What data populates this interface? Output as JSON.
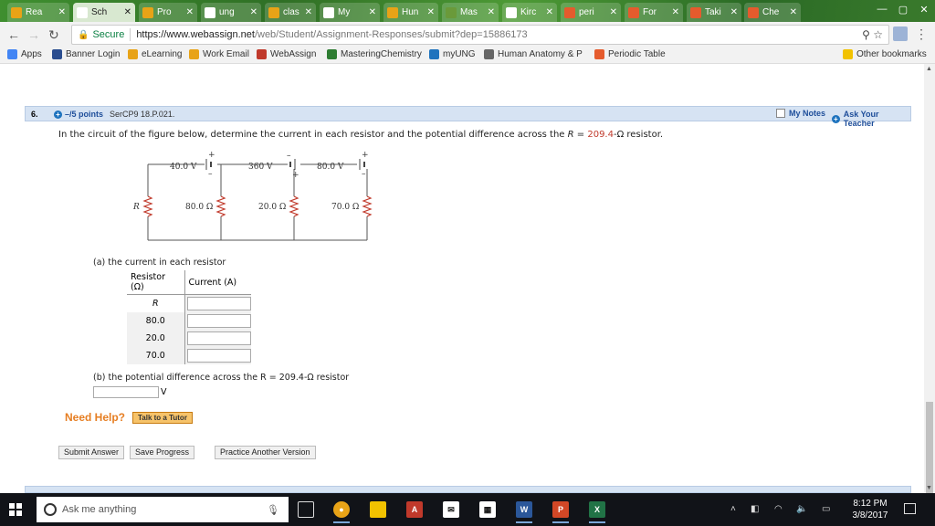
{
  "tabs": [
    {
      "label": "Rea",
      "icon": "scholarship-icon",
      "color": "#e8a317"
    },
    {
      "label": "Sch",
      "icon": "blank-page-icon",
      "color": "#ffffff"
    },
    {
      "label": "Pro",
      "icon": "pro-icon",
      "color": "#e8a317"
    },
    {
      "label": "ung",
      "icon": "blank-page-icon",
      "color": "#ffffff"
    },
    {
      "label": "clas",
      "icon": "class-icon",
      "color": "#e8a317"
    },
    {
      "label": "My",
      "icon": "document-icon",
      "color": "#ffffff"
    },
    {
      "label": "Hun",
      "icon": "hun-icon",
      "color": "#e8a317"
    },
    {
      "label": "Mas",
      "icon": "mastering-icon",
      "color": "#6a9a3a"
    },
    {
      "label": "Kirc",
      "icon": "wikipedia-icon",
      "color": "#ffffff"
    },
    {
      "label": "peri",
      "icon": "periodic-icon",
      "color": "#e55b2d"
    },
    {
      "label": "For",
      "icon": "chegg-icon",
      "color": "#e55b2d"
    },
    {
      "label": "Taki",
      "icon": "chegg-icon",
      "color": "#e55b2d"
    },
    {
      "label": "Che",
      "icon": "chegg-icon",
      "color": "#e55b2d"
    }
  ],
  "omnibox": {
    "secure_label": "Secure",
    "url_host": "https://www.webassign.net",
    "url_path": "/web/Student/Assignment-Responses/submit?dep=15886173"
  },
  "bookmarks": [
    {
      "label": "Apps",
      "icon": "apps-grid-icon",
      "color": "#4285f4"
    },
    {
      "label": "Banner Login",
      "icon": "banner-icon",
      "color": "#2a4d8f"
    },
    {
      "label": "eLearning",
      "icon": "elearning-icon",
      "color": "#e8a317"
    },
    {
      "label": "Work Email",
      "icon": "outlook-icon",
      "color": "#e8a317"
    },
    {
      "label": "WebAssign",
      "icon": "webassign-icon",
      "color": "#c0392b"
    },
    {
      "label": "MasteringChemistry",
      "icon": "mastering-icon",
      "color": "#2e7d32"
    },
    {
      "label": "myUNG",
      "icon": "myung-icon",
      "color": "#1e73be"
    },
    {
      "label": "Human Anatomy & P",
      "icon": "document-icon",
      "color": "#666666"
    },
    {
      "label": "Periodic Table",
      "icon": "periodic-icon",
      "color": "#e55b2d"
    }
  ],
  "other_bookmarks": "Other bookmarks",
  "question": {
    "number": "6.",
    "points": "–/5 points",
    "code": "SerCP9 18.P.021.",
    "my_notes": "My Notes",
    "ask_teacher": "Ask Your Teacher",
    "text_before": "In the circuit of the figure below, determine the current in each resistor and the potential difference across the ",
    "text_R": "R",
    "text_eq": " = ",
    "text_value": "209.4",
    "text_after": "-Ω resistor."
  },
  "circuit": {
    "batteries": [
      "40.0 V",
      "360 V",
      "80.0 V"
    ],
    "resistors": [
      "R",
      "80.0 Ω",
      "20.0 Ω",
      "70.0 Ω"
    ],
    "plus": "+",
    "minus": "–"
  },
  "part_a": {
    "prompt": "(a) the current in each resistor",
    "col_resistor": "Resistor (Ω)",
    "col_current": "Current (A)",
    "rows": [
      "R",
      "80.0",
      "20.0",
      "70.0"
    ]
  },
  "part_b": {
    "prompt": "(b) the potential difference across the R = 209.4-Ω resistor",
    "unit": "V"
  },
  "help": {
    "need_help": "Need Help?",
    "tutor": "Talk to a Tutor"
  },
  "buttons": {
    "submit": "Submit Answer",
    "save": "Save Progress",
    "practice": "Practice Another Version"
  },
  "taskbar": {
    "search_placeholder": "Ask me anything",
    "time": "8:12 PM",
    "date": "3/8/2017"
  }
}
